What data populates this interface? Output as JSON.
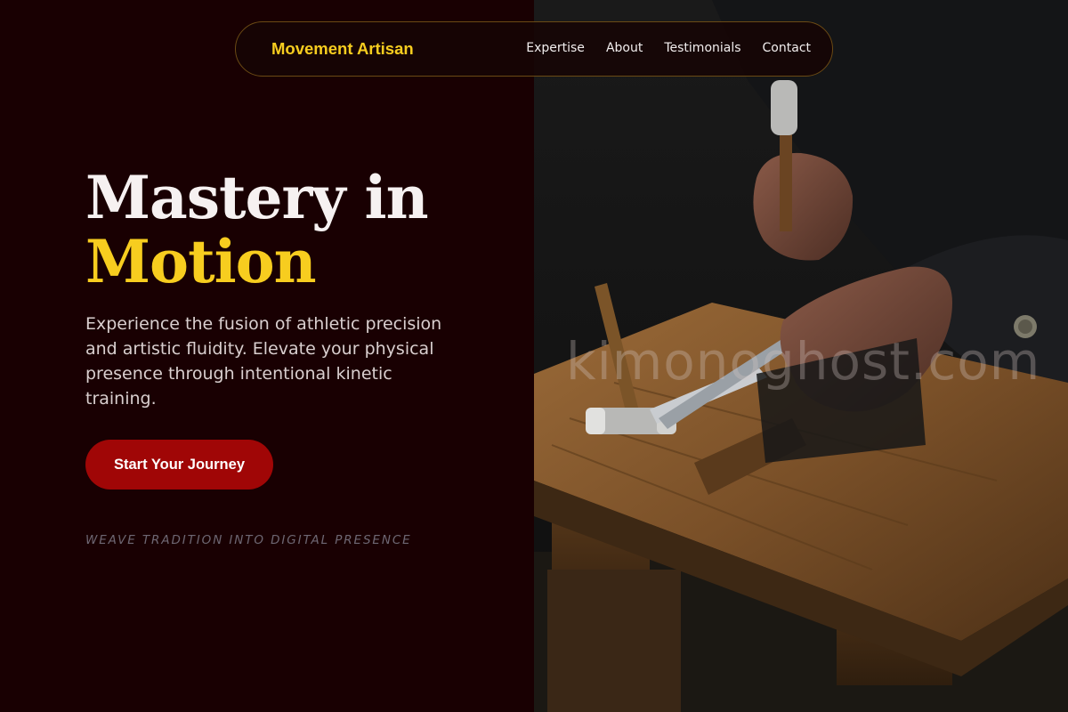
{
  "nav": {
    "brand": "Movement Artisan",
    "links": [
      "Expertise",
      "About",
      "Testimonials",
      "Contact"
    ]
  },
  "hero": {
    "title_line1": "Mastery in",
    "title_line2": "Motion",
    "description": "Experience the fusion of athletic precision and artistic fluidity. Elevate your physical presence through intentional kinetic training.",
    "cta_label": "Start Your Journey",
    "tagline": "WEAVE TRADITION INTO DIGITAL PRESENCE"
  },
  "photo": {
    "watermark": "kimonoghost.com"
  },
  "colors": {
    "background": "#190002",
    "accent_yellow": "#f7cd1f",
    "cta_red": "#a00606"
  },
  "icons": [
    "hammer-icon",
    "pliers-icon"
  ]
}
